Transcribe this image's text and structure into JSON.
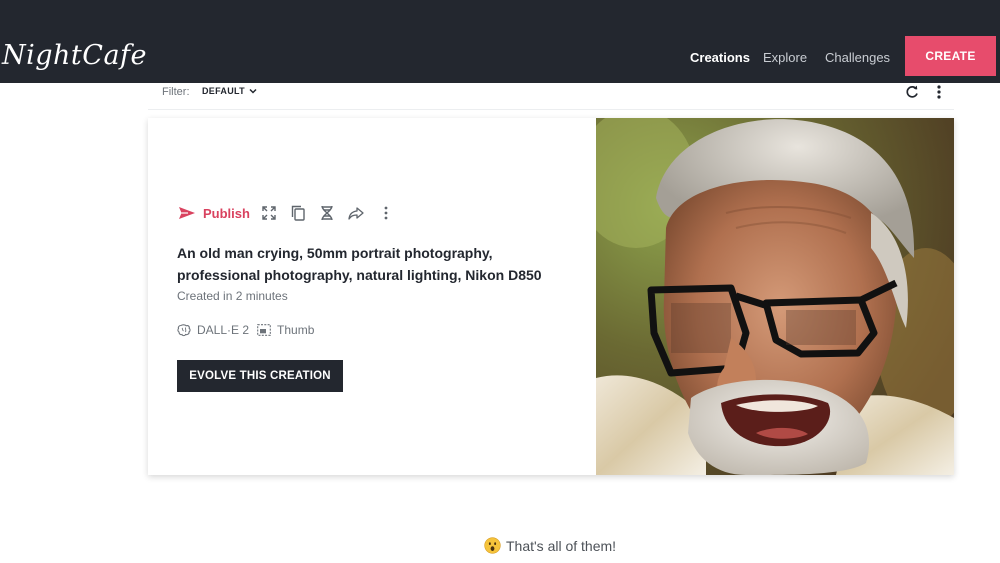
{
  "header": {
    "logo_text": "NightCafe",
    "nav": [
      {
        "label": "Creations",
        "active": true
      },
      {
        "label": "Explore",
        "active": false
      },
      {
        "label": "Challenges",
        "active": false
      }
    ],
    "create_label": "CREATE",
    "accent_color": "#e74c6c",
    "bar_color": "#23272f"
  },
  "filter": {
    "label": "Filter:",
    "value": "DEFAULT"
  },
  "card": {
    "publish_label": "Publish",
    "toolbar_icons": [
      "expand-icon",
      "copy-icon",
      "dna-icon",
      "share-icon",
      "more-vertical-icon"
    ],
    "title": "An old man crying, 50mm portrait photography, professional photography, natural lighting, Nikon D850",
    "created": "Created in 2 minutes",
    "model": "DALL·E 2",
    "size": "Thumb",
    "evolve_label": "EVOLVE THIS CREATION",
    "image_alt": "Elderly man with grey hair and beard, wearing black glasses, crying"
  },
  "footer": {
    "end_message": "That's all of them!"
  }
}
